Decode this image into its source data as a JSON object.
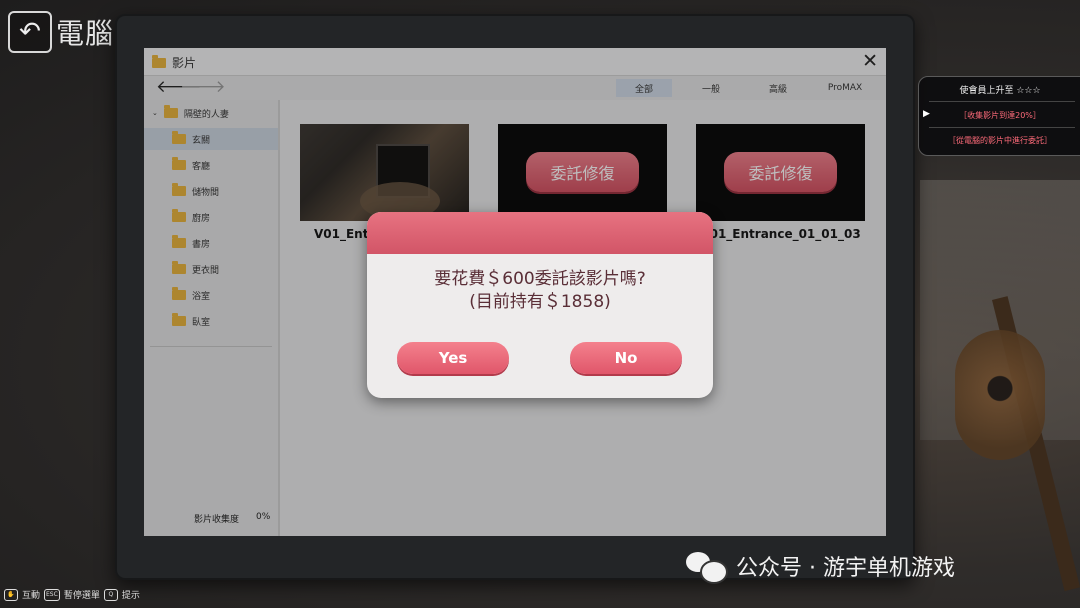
{
  "header": {
    "title": "電腦",
    "back_icon": "back-arrow-icon"
  },
  "explorer": {
    "title": "影片",
    "tabs": [
      {
        "label": "全部",
        "active": true
      },
      {
        "label": "一般",
        "active": false
      },
      {
        "label": "高級",
        "active": false
      },
      {
        "label": "ProMAX",
        "active": false
      }
    ],
    "tree_root": "隔壁的人妻",
    "folders": [
      "玄關",
      "客廳",
      "儲物間",
      "廚房",
      "書房",
      "更衣間",
      "浴室",
      "臥室"
    ],
    "selected_folder": "玄關",
    "collection_label": "影片收集度",
    "collection_value": "0%",
    "videos": [
      {
        "label": "V01_Entr",
        "state": "restored"
      },
      {
        "label": "",
        "state": "damaged",
        "button": "委託修復"
      },
      {
        "label": "V01_Entrance_01_01_03",
        "state": "damaged",
        "button": "委託修復"
      }
    ]
  },
  "dialog": {
    "line1": "要花費＄600委託該影片嗎?",
    "line2": "(目前持有＄1858)",
    "yes_label": "Yes",
    "no_label": "No"
  },
  "quest": {
    "title": "使會員上升至 ☆☆☆",
    "line1": "［收集影片到達20%］",
    "line2": "［從電腦的影片中進行委託］"
  },
  "hints": [
    {
      "key": "✋",
      "label": "互動"
    },
    {
      "key": "ESC",
      "label": "暫停選單"
    },
    {
      "key": "Q",
      "label": "提示"
    }
  ],
  "watermark": "公众号 · 游宇单机游戏",
  "colors": {
    "accent_pink": "#e0566a",
    "quest_red": "#ff6b7a",
    "selected_tab": "#cfd9e6"
  }
}
